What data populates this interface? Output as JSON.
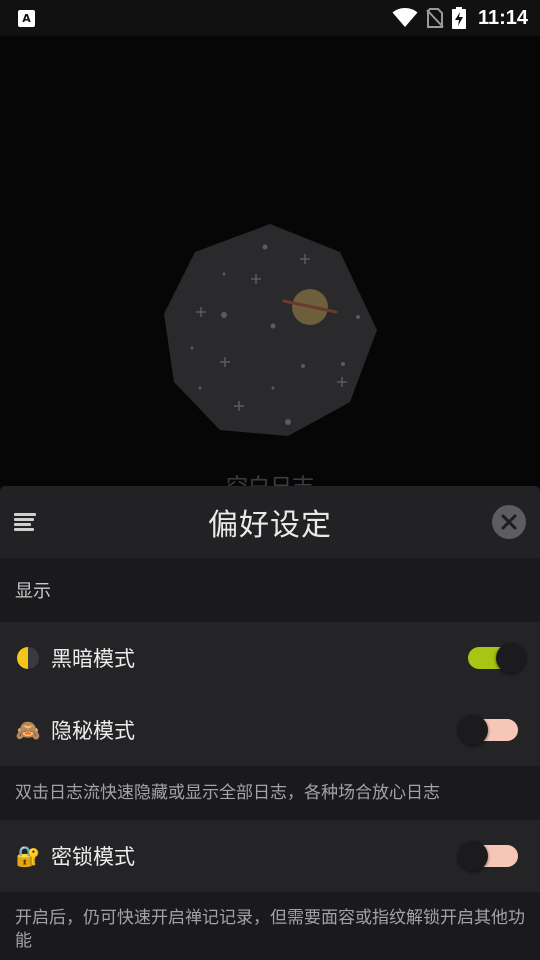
{
  "status_bar": {
    "app_badge": "A",
    "time": "11:14",
    "icons": [
      "wifi-icon",
      "no-sim-icon",
      "battery-charging-icon"
    ]
  },
  "background": {
    "empty_caption": "空白日志",
    "illustration": "planet-octagon-illustration"
  },
  "sheet": {
    "title": "偏好设定",
    "menu_icon": "menu-icon",
    "close_icon": "close-icon",
    "section_display": "显示",
    "settings": [
      {
        "label": "黑暗模式",
        "icon": "half-moon-icon",
        "enabled": true
      },
      {
        "label": "隐秘模式",
        "icon": "see-no-evil-monkey-icon",
        "emoji": "🙈",
        "enabled": false,
        "description": "双击日志流快速隐藏或显示全部日志，各种场合放心日志"
      },
      {
        "label": "密锁模式",
        "icon": "lock-with-key-icon",
        "emoji": "🔐",
        "enabled": false,
        "description": "开启后，仍可快速开启禅记记录，但需要面容或指纹解锁开启其他功能"
      }
    ]
  },
  "colors": {
    "toggle_on": "#a8c514",
    "toggle_off": "#f6c7b7",
    "sheet_bg": "#1f1f21"
  }
}
